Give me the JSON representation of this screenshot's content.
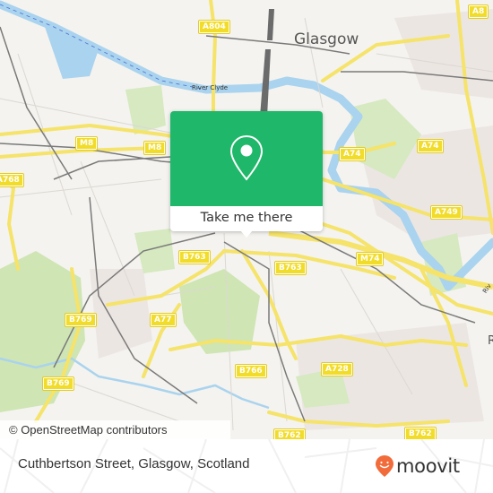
{
  "map": {
    "city_label": "Glasgow",
    "river_label": "River Clyde",
    "edge_label_right": "R",
    "edge_label_river_right": "Riv",
    "road_shields": [
      {
        "id": "a804",
        "label": "A804"
      },
      {
        "id": "a8",
        "label": "A8"
      },
      {
        "id": "m8-west",
        "label": "M8"
      },
      {
        "id": "m8-east",
        "label": "M8"
      },
      {
        "id": "a768",
        "label": "A768"
      },
      {
        "id": "a74-west",
        "label": "A74"
      },
      {
        "id": "a74-east",
        "label": "A74"
      },
      {
        "id": "a749",
        "label": "A749"
      },
      {
        "id": "m74",
        "label": "M74"
      },
      {
        "id": "b763-west",
        "label": "B763"
      },
      {
        "id": "b763-east",
        "label": "B763"
      },
      {
        "id": "b769-north",
        "label": "B769"
      },
      {
        "id": "b769-south",
        "label": "B769"
      },
      {
        "id": "a77",
        "label": "A77"
      },
      {
        "id": "b766",
        "label": "B766"
      },
      {
        "id": "a728",
        "label": "A728"
      },
      {
        "id": "b762-west",
        "label": "B762"
      },
      {
        "id": "b762-east",
        "label": "B762"
      }
    ],
    "colors": {
      "land": "#f4f3ef",
      "water": "#a9d3ee",
      "park": "#cfe5b4",
      "road_major": "#f5e36a",
      "rail": "#7a7a7a"
    }
  },
  "popup": {
    "action_label": "Take me there",
    "icon": "map-pin-icon",
    "accent_color": "#1fb86a"
  },
  "attribution": "© OpenStreetMap contributors",
  "footer": {
    "address": "Cuthbertson Street, Glasgow, Scotland",
    "brand": "moovit",
    "brand_color": "#f26b3a"
  }
}
